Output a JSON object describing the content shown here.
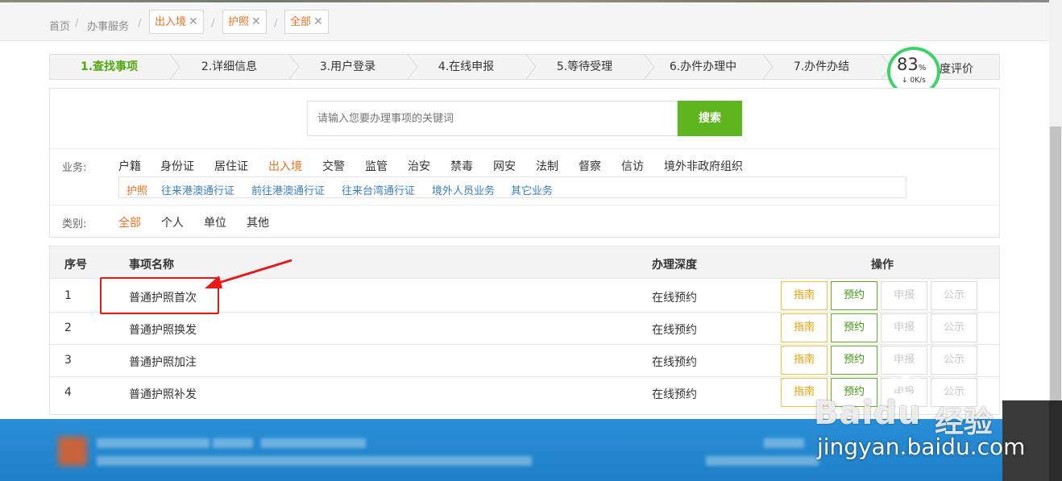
{
  "breadcrumb": {
    "home": "首页",
    "service": "办事服务",
    "tags": [
      "出入境",
      "护照",
      "全部"
    ],
    "close_glyph": "✕"
  },
  "steps": [
    {
      "label": "1.查找事项",
      "active": true
    },
    {
      "label": "2.详细信息",
      "active": false
    },
    {
      "label": "3.用户登录",
      "active": false
    },
    {
      "label": "4.在线申报",
      "active": false
    },
    {
      "label": "5.等待受理",
      "active": false
    },
    {
      "label": "6.办件办理中",
      "active": false
    },
    {
      "label": "7.办件办结",
      "active": false
    },
    {
      "label": "度评价",
      "active": false
    }
  ],
  "speed_badge": {
    "percent": "83",
    "percent_sign": "%",
    "rate": "0K/s"
  },
  "search": {
    "placeholder": "请输入您要办理事项的关键词",
    "button": "搜索"
  },
  "filters": {
    "business_label": "业务:",
    "business_items": [
      "户籍",
      "身份证",
      "居住证",
      "出入境",
      "交警",
      "监管",
      "治安",
      "禁毒",
      "网安",
      "法制",
      "督察",
      "信访",
      "境外非政府组织"
    ],
    "business_selected": "出入境",
    "sub_items": [
      "护照",
      "往来港澳通行证",
      "前往港澳通行证",
      "往来台湾通行证",
      "境外人员业务",
      "其它业务"
    ],
    "sub_selected": "护照",
    "category_label": "类别:",
    "category_items": [
      "全部",
      "个人",
      "单位",
      "其他"
    ],
    "category_selected": "全部"
  },
  "table": {
    "headers": {
      "index": "序号",
      "name": "事项名称",
      "depth": "办理深度",
      "ops": "操作"
    },
    "rows": [
      {
        "index": "1",
        "name": "普通护照首次",
        "depth": "在线预约"
      },
      {
        "index": "2",
        "name": "普通护照换发",
        "depth": "在线预约"
      },
      {
        "index": "3",
        "name": "普通护照加注",
        "depth": "在线预约"
      },
      {
        "index": "4",
        "name": "普通护照补发",
        "depth": "在线预约"
      }
    ],
    "op_labels": {
      "guide": "指南",
      "book": "预约",
      "apply": "申报",
      "public": "公示"
    }
  },
  "watermark": {
    "brand": "Bai",
    "brand2": "du",
    "cn": "经验",
    "url": "jingyan.baidu.com"
  },
  "colors": {
    "accent_green": "#5cb51c",
    "accent_orange": "#f07020",
    "link_blue": "#3a7fc1",
    "annotation_red": "#e81818",
    "footer_blue": "#2a8fd8"
  }
}
